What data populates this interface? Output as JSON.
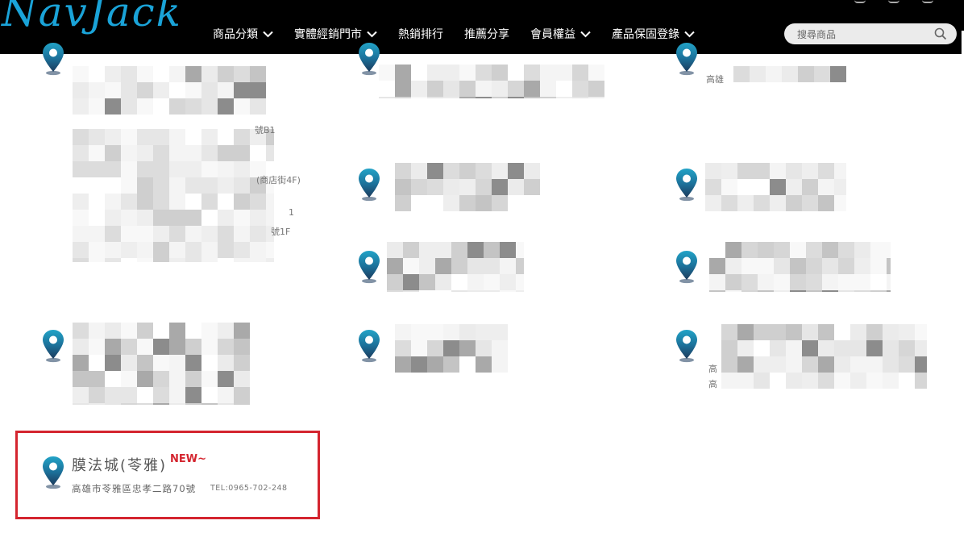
{
  "header": {
    "logo_text": "NavJack",
    "nav": [
      {
        "label": "商品分類",
        "has_dropdown": true
      },
      {
        "label": "實體經銷門市",
        "has_dropdown": true
      },
      {
        "label": "熱銷排行",
        "has_dropdown": false
      },
      {
        "label": "推薦分享",
        "has_dropdown": false
      },
      {
        "label": "會員權益",
        "has_dropdown": true
      },
      {
        "label": "產品保固登錄",
        "has_dropdown": true
      }
    ],
    "search_placeholder": "搜尋商品"
  },
  "highlighted_store": {
    "name": "膜法城(苓雅)",
    "badge": "NEW~",
    "address": "高雄市苓雅區忠孝二路70號",
    "tel": "TEL:0965-702-248"
  },
  "visible_fragments": {
    "frag1": "號B1",
    "frag2": "(商店街4F)",
    "frag3": "1",
    "frag4": "號1F",
    "frag5": "高雄",
    "frag6": "高",
    "frag7": "高"
  },
  "colors": {
    "header_bg": "#000000",
    "logo": "#1aa3d8",
    "pin_top": "#1f8fb8",
    "pin_bottom": "#1b3a5c",
    "highlight_border": "#d4252f",
    "new_badge": "#d4252f"
  },
  "icons": {
    "location": "map-pin-icon",
    "search": "search-icon",
    "dropdown": "chevron-down-icon"
  }
}
